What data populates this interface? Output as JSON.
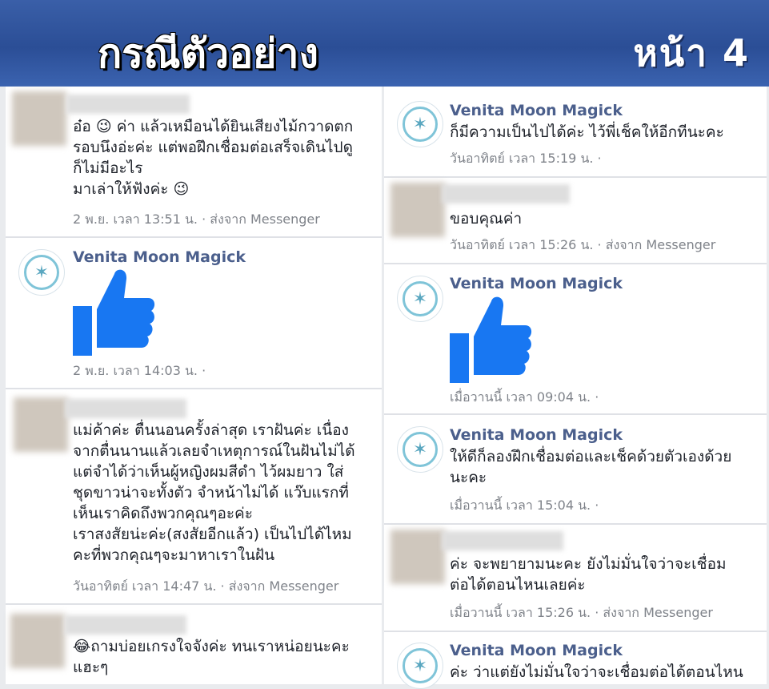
{
  "header": {
    "title": "กรณีตัวอย่าง",
    "page": "หน้า 4"
  },
  "left": [
    {
      "lines": [
        "อ๋อ 😉 ค่า แล้วเหมือนได้ยินเสียงไม้กวาดตก",
        "รอบนึงอ่ะค่ะ แต่พอฝึกเชื่อมต่อเสร็จเดินไปดู",
        "ก็ไม่มีอะไร",
        "มาเล่าให้ฟังค่ะ 😉"
      ],
      "meta": "2 พ.ย. เวลา 13:51 น. · ส่งจาก Messenger"
    },
    {
      "name": "Venita Moon Magick",
      "meta": "2 พ.ย. เวลา 14:03 น. ·"
    },
    {
      "lines": [
        "แม่ค้าค่ะ ตื่นนอนครั้งล่าสุด เราฝันค่ะ เนื่อง",
        "จากตื่นนานแล้วเลยจำเหตุการณ์ในฝันไม่ได้",
        "แต่จำได้ว่าเห็นผู้หญิงผมสีดำ ไว้ผมยาว ใส่",
        "ชุดขาวน่าจะทั้งตัว จำหน้าไม่ได้ แว๊บแรกที่",
        "เห็นเราคิดถึงพวกคุณๆอะค่ะ",
        "เราสงสัยน่ะค่ะ(สงสัยอีกแล้ว) เป็นไปได้ไหม",
        "คะที่พวกคุณๆจะมาหาเราในฝัน"
      ],
      "meta": "วันอาทิตย์ เวลา 14:47 น. · ส่งจาก Messenger"
    },
    {
      "lines": [
        "😂ถามบ่อยเกรงใจจังค่ะ ทนเราหน่อยนะคะ",
        "แฮะๆ"
      ]
    }
  ],
  "right": [
    {
      "name": "Venita Moon Magick",
      "lines": [
        "ก็มีความเป็นไปได้ค่ะ ไว้พี่เช็คให้อีกทีนะคะ"
      ],
      "meta": "วันอาทิตย์ เวลา 15:19 น. ·"
    },
    {
      "lines": [
        "ขอบคุณค่า"
      ],
      "meta": "วันอาทิตย์ เวลา 15:26 น. · ส่งจาก Messenger"
    },
    {
      "name": "Venita Moon Magick",
      "meta": "เมื่อวานนี้ เวลา 09:04 น. ·"
    },
    {
      "name": "Venita Moon Magick",
      "lines": [
        "ให้ดีก็ลองฝึกเชื่อมต่อและเช็คด้วยตัวเองด้วย",
        "นะคะ"
      ],
      "meta": "เมื่อวานนี้ เวลา 15:04 น. ·"
    },
    {
      "lines": [
        "ค่ะ จะพยายามนะคะ ยังไม่มั่นใจว่าจะเชื่อม",
        "ต่อได้ตอนไหนเลยค่ะ"
      ],
      "meta": "เมื่อวานนี้ เวลา 15:26 น. · ส่งจาก Messenger"
    },
    {
      "name": "Venita Moon Magick",
      "lines": [
        "ค่ะ ว่าแต่ยังไม่มั่นใจว่าจะเชื่อมต่อได้ตอนไหน"
      ]
    }
  ],
  "colors": {
    "header": "#2b4e96",
    "like": "#1877f2",
    "name": "#4b5f8c"
  },
  "icons": {
    "like": "thumbs-up-icon",
    "logo": "venita-moon-magick-logo"
  }
}
